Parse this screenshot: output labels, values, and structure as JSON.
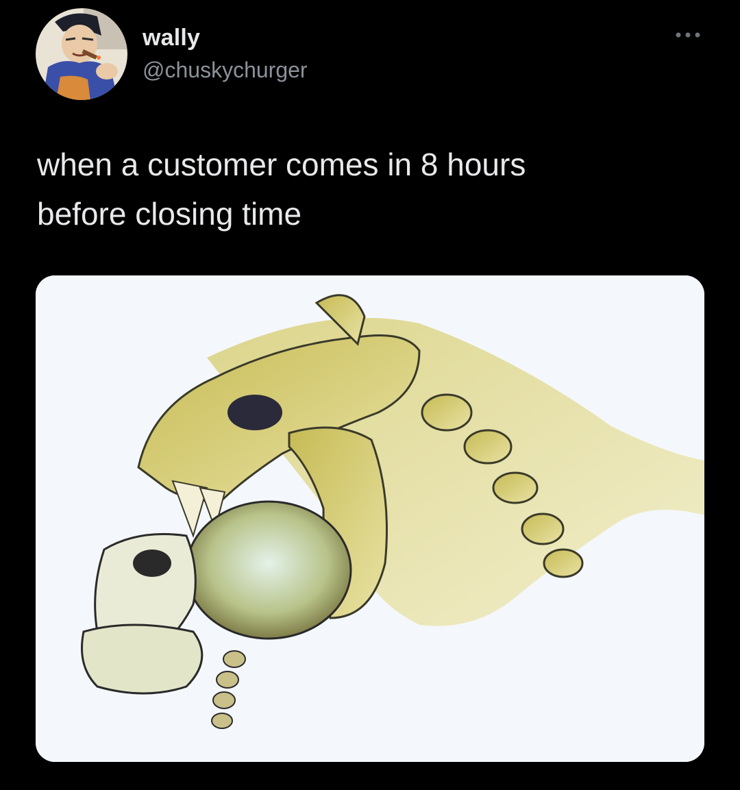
{
  "tweet": {
    "author": {
      "display_name": "wally",
      "handle": "@chuskychurger",
      "avatar_icon": "cartoon-character-avatar-icon"
    },
    "more_icon": "more-options-icon",
    "text": "when a customer comes in 8 hours\nbefore closing time",
    "media": {
      "kind": "image",
      "subject": "drawing of a sabertooth cat skull biting down on a human skull",
      "accent_color": "#c9c06a"
    }
  },
  "colors": {
    "background": "#000000",
    "text_primary": "#e7e9ea",
    "text_secondary": "#8b9299",
    "media_background": "#f4f8fd"
  }
}
